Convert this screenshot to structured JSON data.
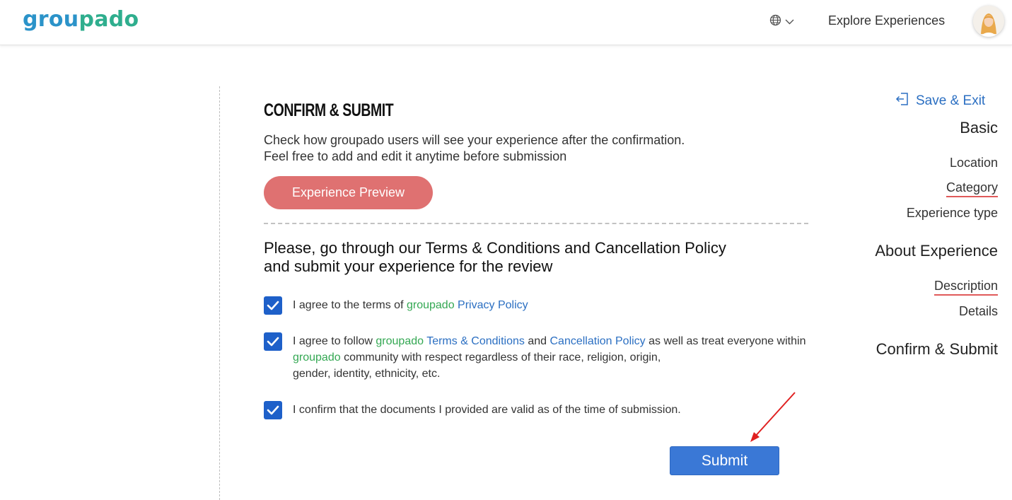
{
  "header": {
    "logo_part1": "grou",
    "logo_part2": "pado",
    "nav_explore": "Explore Experiences"
  },
  "sidebar": {
    "sections": [
      {
        "label": "Basic",
        "items": [
          "Location",
          "Category",
          "Experience type"
        ]
      },
      {
        "label": "About Experience",
        "items": [
          "Description",
          "Details"
        ]
      },
      {
        "label": "Confirm & Submit",
        "items": []
      }
    ]
  },
  "main": {
    "title": "CONFIRM & SUBMIT",
    "desc_line1": "Check how groupado users will see your experience after the confirmation.",
    "desc_line2": "Feel free to add and edit it anytime before submission",
    "preview_button": "Experience Preview",
    "terms_line1": "Please, go through our Terms & Conditions and Cancellation Policy",
    "terms_line2": "and submit your experience for the review",
    "checks": [
      {
        "checked": true,
        "prefix": "I agree to the terms of ",
        "brand": "groupado",
        "link": "Privacy Policy"
      },
      {
        "checked": true,
        "prefix": "I agree to follow ",
        "brand1": "groupado",
        "link1": "Terms & Conditions",
        "mid": " and ",
        "link2": "Cancellation Policy",
        "suffix": " as well as treat everyone within",
        "brand2": "groupado",
        "line2": " community with respect regardless of their race, religion, origin,",
        "line3": "gender, identity, ethnicity, etc."
      },
      {
        "checked": true,
        "text": "I confirm that the documents I provided are valid as of the time of submission."
      }
    ],
    "save_exit": "Save & Exit",
    "submit_button": "Submit"
  },
  "colors": {
    "brand_blue": "#2b93c9",
    "brand_green": "#2fae8e",
    "preview_button": "#df7171",
    "submit_button": "#3a78d6",
    "checkbox": "#1e60c9",
    "link": "#2b6fc2",
    "underline_active": "#e05a5a",
    "annotation_arrow": "#e02020"
  }
}
